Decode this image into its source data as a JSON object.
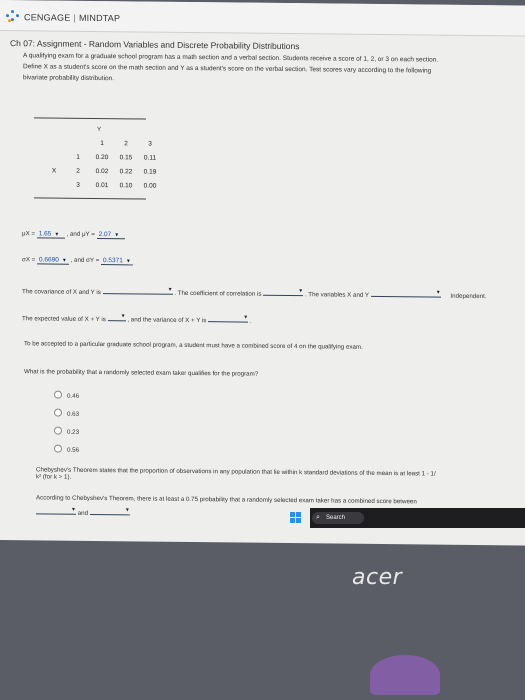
{
  "brand": {
    "name1": "CENGAGE",
    "name2": "MINDTAP"
  },
  "assignment": {
    "title": "Ch 07: Assignment - Random Variables and Discrete Probability Distributions",
    "para1": "A qualifying exam for a graduate school program has a math section and a verbal section. Students receive a score of 1, 2, or 3 on each section.",
    "para2": "Define X as a student's score on the math section and Y as a student's score on the verbal section. Test scores vary according to the following",
    "para3": "bivariate probability distribution."
  },
  "table": {
    "y_label": "Y",
    "x_label": "X",
    "cols": [
      "1",
      "2",
      "3"
    ],
    "rows": [
      {
        "x": "1",
        "vals": [
          "0.20",
          "0.15",
          "0.11"
        ]
      },
      {
        "x": "2",
        "vals": [
          "0.02",
          "0.22",
          "0.19"
        ]
      },
      {
        "x": "3",
        "vals": [
          "0.01",
          "0.10",
          "0.00"
        ]
      }
    ]
  },
  "means": {
    "mux_label": "μX =",
    "mux": "1.65",
    "and": ", and μY =",
    "muy": "2.07"
  },
  "sds": {
    "sx_label": "σX =",
    "sx": "0.6690",
    "and": ", and σY =",
    "sy": "0.5371"
  },
  "cov": {
    "t1": "The covariance of X and Y is",
    "t2": ". The coefficient of correlation is",
    "t3": ". The variables X and Y",
    "t4": "Independent."
  },
  "expect": {
    "t1": "The expected value of X + Y is",
    "t2": ", and the variance of X + Y is",
    "t3": "."
  },
  "admit": "To be accepted to a particular graduate school program, a student must have a combined score of 4 on the qualifying exam.",
  "question": "What is the probability that a randomly selected exam taker qualifies for the program?",
  "options": [
    "0.46",
    "0.63",
    "0.23",
    "0.56"
  ],
  "cheb1": "Chebyshev's Theorem states that the proportion of observations in any population that lie within k standard deviations of the mean is at least 1 - 1/",
  "cheb2": "k² (for k > 1).",
  "cheb3": "According to Chebyshev's Theorem, there is at least a 0.75 probability that a randomly selected exam taker has a combined score between",
  "cheb_and": "and",
  "taskbar": {
    "search": "Search"
  },
  "laptop_brand": "acer"
}
